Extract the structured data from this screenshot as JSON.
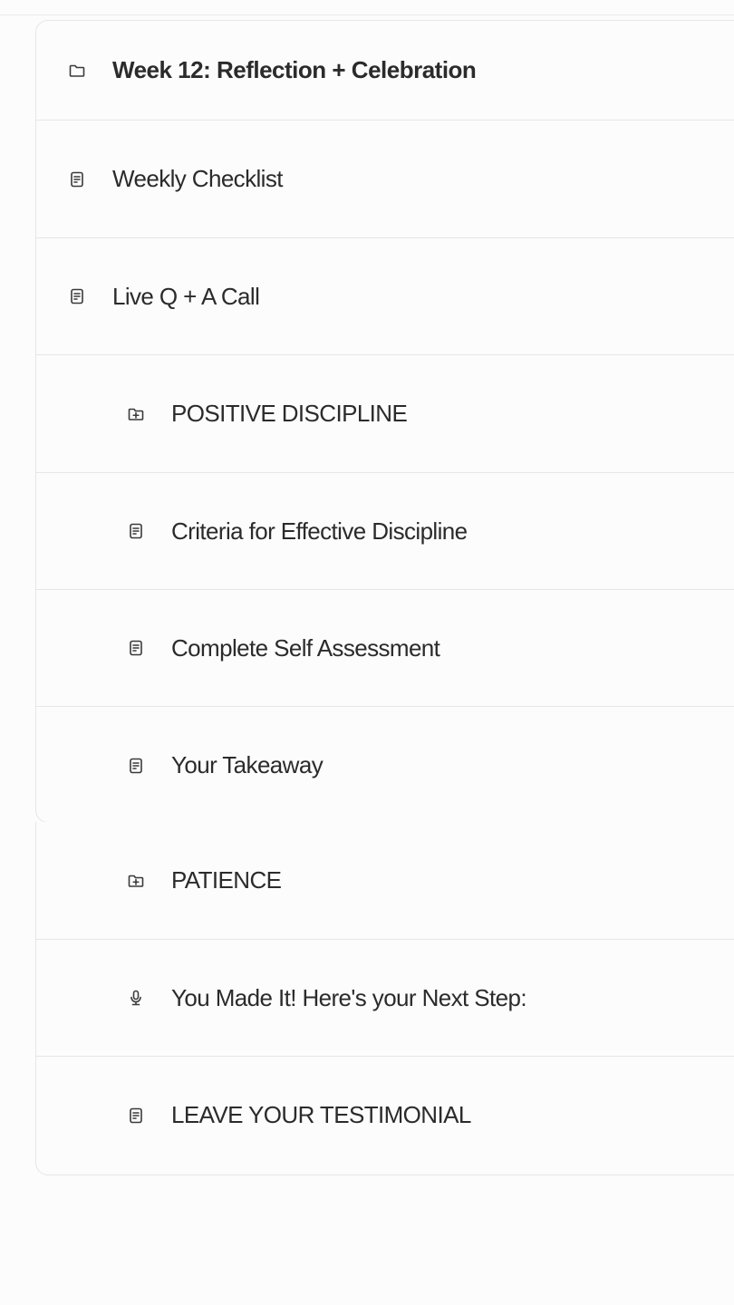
{
  "course": {
    "module": {
      "title": "Week 12: Reflection + Celebration",
      "icon": "folder-icon"
    },
    "items": [
      {
        "label": "Weekly Checklist",
        "icon": "document-icon"
      },
      {
        "label": "Live Q + A Call",
        "icon": "document-icon"
      },
      {
        "label": "POSITIVE DISCIPLINE",
        "icon": "folder-plus-icon"
      },
      {
        "label": "Criteria for Effective Discipline",
        "icon": "document-icon"
      },
      {
        "label": "Complete Self Assessment",
        "icon": "document-icon"
      },
      {
        "label": "Your Takeaway",
        "icon": "document-icon"
      },
      {
        "label": "PATIENCE",
        "icon": "folder-plus-icon"
      },
      {
        "label": "You Made It! Here's your Next Step:",
        "icon": "microphone-icon"
      },
      {
        "label": "LEAVE YOUR TESTIMONIAL",
        "icon": "document-icon"
      }
    ]
  }
}
